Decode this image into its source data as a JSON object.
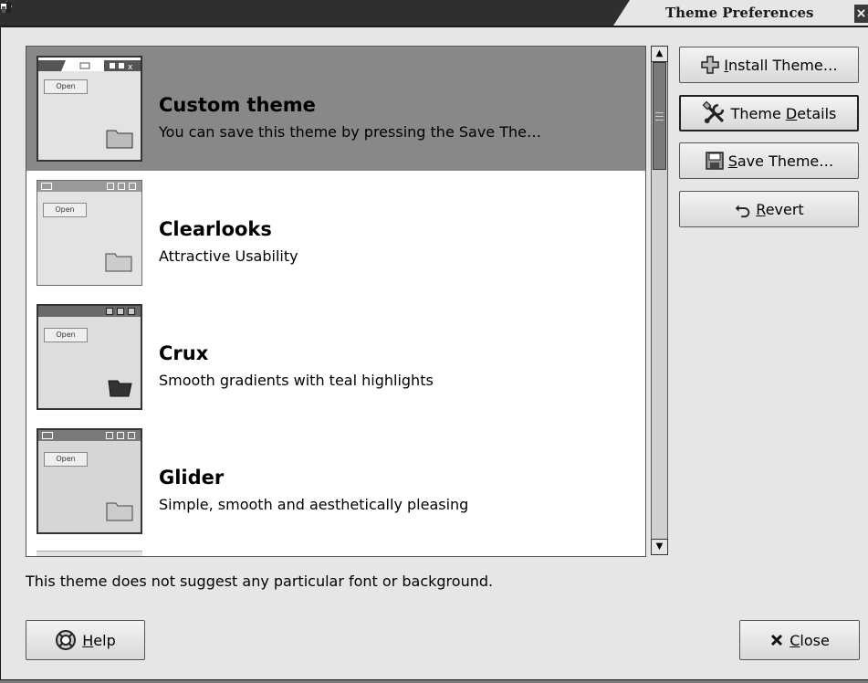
{
  "window": {
    "title": "Theme Preferences",
    "close_glyph": "×",
    "menu_icon": "window-menu-icon"
  },
  "themes": [
    {
      "name": "Custom theme",
      "description": "You can save this theme by pressing the Save The…",
      "selected": true,
      "open_label": "Open"
    },
    {
      "name": "Clearlooks",
      "description": "Attractive Usability",
      "selected": false,
      "open_label": "Open"
    },
    {
      "name": "Crux",
      "description": "Smooth gradients with teal highlights",
      "selected": false,
      "open_label": "Open"
    },
    {
      "name": "Glider",
      "description": "Simple, smooth and aesthetically pleasing",
      "selected": false,
      "open_label": "Open"
    }
  ],
  "scrollbar": {
    "position": 0.0
  },
  "actions": {
    "install": {
      "pre": "",
      "key": "I",
      "post": "nstall Theme…",
      "icon": "install-icon"
    },
    "details": {
      "pre": "Theme ",
      "key": "D",
      "post": "etails",
      "icon": "tools-icon"
    },
    "save": {
      "pre": "",
      "key": "S",
      "post": "ave Theme…",
      "icon": "floppy-icon"
    },
    "revert": {
      "pre": "",
      "key": "R",
      "post": "evert",
      "icon": "revert-icon"
    }
  },
  "hint": "This theme does not suggest any particular font or background.",
  "footer": {
    "help": {
      "key": "H",
      "post": "elp",
      "icon": "help-icon"
    },
    "close": {
      "key": "C",
      "post": "lose",
      "icon": "close-x-icon"
    }
  }
}
